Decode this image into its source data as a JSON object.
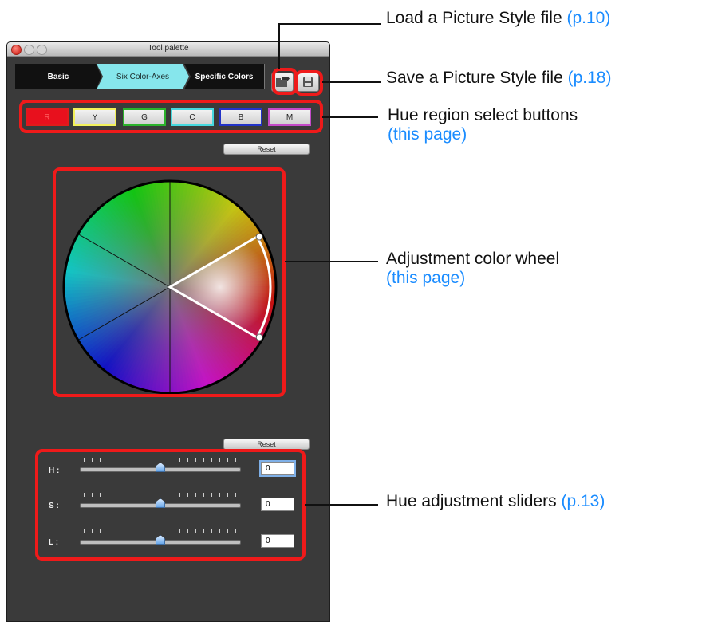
{
  "window": {
    "title": "Tool palette"
  },
  "tabs": [
    "Basic",
    "Six Color-Axes",
    "Specific Colors"
  ],
  "hue_buttons": [
    {
      "label": "R",
      "border": "#e01b1b",
      "fill": "#e8101d",
      "text": "#ff6060"
    },
    {
      "label": "Y",
      "border": "#f2f05a"
    },
    {
      "label": "G",
      "border": "#2bb22b"
    },
    {
      "label": "C",
      "border": "#46d8de"
    },
    {
      "label": "B",
      "border": "#2233c8"
    },
    {
      "label": "M",
      "border": "#c44ac8"
    }
  ],
  "reset_label": "Reset",
  "sliders": [
    {
      "label": "H :",
      "value": "0",
      "position": 0.5
    },
    {
      "label": "S :",
      "value": "0",
      "position": 0.5
    },
    {
      "label": "L :",
      "value": "0",
      "position": 0.5
    }
  ],
  "callouts": {
    "load": {
      "text": "Load a Picture Style file",
      "ref": "(p.10)"
    },
    "save": {
      "text": "Save a Picture Style file",
      "ref": "(p.18)"
    },
    "hue_buttons": {
      "text": "Hue region select buttons",
      "ref": "(this page)"
    },
    "wheel": {
      "text": "Adjustment color wheel",
      "ref": "(this page)"
    },
    "sliders": {
      "text": "Hue adjustment sliders",
      "ref": "(p.13)"
    }
  },
  "colors": {
    "highlight": "#ef1a1a",
    "link": "#1a8cff",
    "active_tab": "#86e6ec"
  }
}
